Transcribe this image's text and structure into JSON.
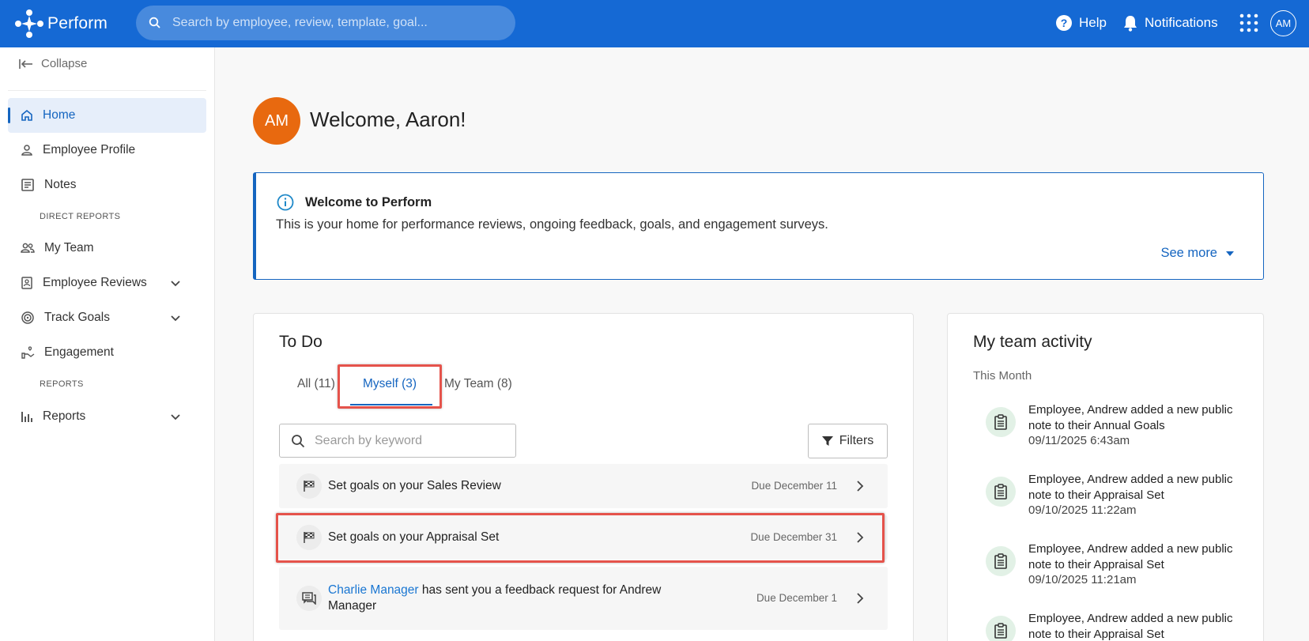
{
  "app": {
    "name": "Perform"
  },
  "header": {
    "search_placeholder": "Search by employee, review, template, goal...",
    "help_label": "Help",
    "notifications_label": "Notifications",
    "user_initials": "AM"
  },
  "sidebar": {
    "collapse_label": "Collapse",
    "items": [
      {
        "label": "Home",
        "icon": "home-icon",
        "active": true
      },
      {
        "label": "Employee Profile",
        "icon": "person-icon"
      },
      {
        "label": "Notes",
        "icon": "notes-icon"
      }
    ],
    "direct_reports_label": "DIRECT REPORTS",
    "direct_items": [
      {
        "label": "My Team",
        "icon": "team-icon"
      },
      {
        "label": "Employee Reviews",
        "icon": "review-icon",
        "expandable": true
      },
      {
        "label": "Track Goals",
        "icon": "target-icon",
        "expandable": true
      },
      {
        "label": "Engagement",
        "icon": "engagement-icon"
      }
    ],
    "reports_label": "REPORTS",
    "report_items": [
      {
        "label": "Reports",
        "icon": "bar-chart-icon",
        "expandable": true
      }
    ]
  },
  "welcome": {
    "initials": "AM",
    "title": "Welcome, Aaron!"
  },
  "info_box": {
    "title": "Welcome to Perform",
    "body": "This is your home for performance reviews, ongoing feedback, goals, and engagement surveys.",
    "see_more": "See more"
  },
  "todo": {
    "title": "To Do",
    "tabs": [
      {
        "label": "All (11)"
      },
      {
        "label": "Myself (3)",
        "active": true
      },
      {
        "label": "My Team (8)"
      }
    ],
    "search_placeholder": "Search by keyword",
    "filters_label": "Filters",
    "rows": [
      {
        "text": "Set goals on your Sales Review",
        "due": "Due December 11",
        "icon": "flag-icon"
      },
      {
        "text": "Set goals on your Appraisal Set",
        "due": "Due December 31",
        "icon": "flag-icon"
      },
      {
        "link": "Charlie Manager",
        "text_after": " has sent you a feedback request for Andrew Manager",
        "due": "Due December 1",
        "icon": "feedback-icon"
      }
    ]
  },
  "activity": {
    "title": "My team activity",
    "subtitle": "This Month",
    "items": [
      {
        "text": "Employee, Andrew added a new public note to their Annual Goals",
        "time": "09/11/2025 6:43am"
      },
      {
        "text": "Employee, Andrew added a new public note to their Appraisal Set",
        "time": "09/10/2025 11:22am"
      },
      {
        "text": "Employee, Andrew added a new public note to their Appraisal Set",
        "time": "09/10/2025 11:21am"
      },
      {
        "text": "Employee, Andrew added a new public note to their Appraisal Set",
        "time": ""
      }
    ]
  },
  "colors": {
    "brand": "#1569d4",
    "accent": "#1565c0",
    "avatar": "#e8690f",
    "highlight": "#e5534b"
  }
}
